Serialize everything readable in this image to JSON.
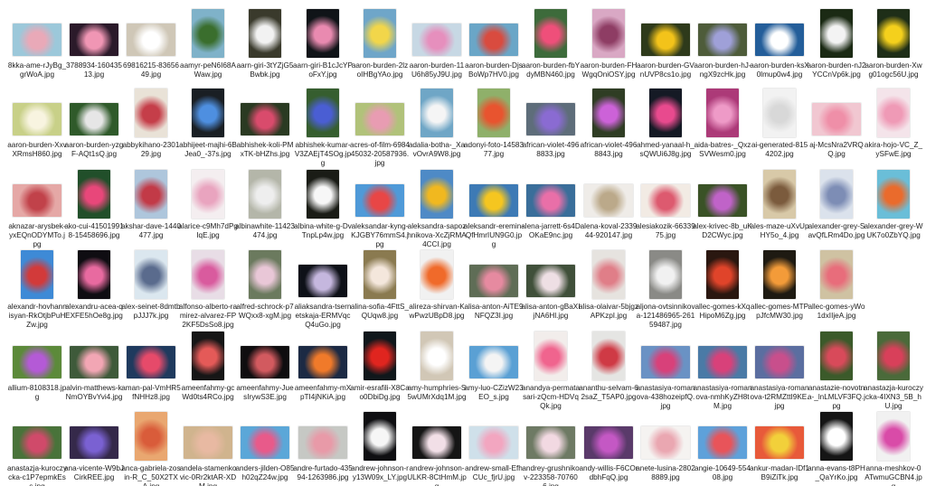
{
  "rows": [
    [
      {
        "label": "8kka-ame-rJyBg_grWoA.jpg",
        "orient": "l",
        "c1": "#9cc8da",
        "c2": "#e9a9b8"
      },
      {
        "label": "3788934-16043513.jpg",
        "orient": "l",
        "c1": "#2b1a2a",
        "c2": "#f096b4"
      },
      {
        "label": "69816215-8365649.jpg",
        "orient": "l",
        "c1": "#cfc7b7",
        "c2": "#ffffff"
      },
      {
        "label": "aamyr-peN6I68AWaw.jpg",
        "orient": "p",
        "c1": "#7fb2c9",
        "c2": "#3a6e2d"
      },
      {
        "label": "aarn-giri-3tYZjG5Bwbk.jpg",
        "orient": "p",
        "c1": "#3a3a2c",
        "c2": "#f2f2f2"
      },
      {
        "label": "aarn-giri-B1cJcYPoFxY.jpg",
        "orient": "p",
        "c1": "#101418",
        "c2": "#e98ab0"
      },
      {
        "label": "aaron-burden-2lzoIHBgYAo.jpg",
        "orient": "p",
        "c1": "#6fa6c9",
        "c2": "#f2d64a"
      },
      {
        "label": "aaron-burden-11U6h85yJ9U.jpg",
        "orient": "l",
        "c1": "#c7d8e4",
        "c2": "#e68fbd"
      },
      {
        "label": "aaron-burden-DjsBoWp7HV0.jpg",
        "orient": "l",
        "c1": "#6aa6c7",
        "c2": "#d94b3f"
      },
      {
        "label": "aaron-burden-fbYdyMBN460.jpg",
        "orient": "p",
        "c1": "#3d6b3b",
        "c2": "#ef4f7a"
      },
      {
        "label": "aaron-burden-FHWgqOniOSY.jpg",
        "orient": "p",
        "c1": "#d9a8c4",
        "c2": "#8e3d64"
      },
      {
        "label": "aaron-burden-GVnUVP8cs1o.jpg",
        "orient": "l",
        "c1": "#2e3a1b",
        "c2": "#f3c31a"
      },
      {
        "label": "aaron-burden-hJ-ngX9zcHk.jpg",
        "orient": "l",
        "c1": "#4e5c3a",
        "c2": "#9fa0d8"
      },
      {
        "label": "aaron-burden-ksX0lmup0w4.jpg",
        "orient": "l",
        "c1": "#245e9a",
        "c2": "#ffffff"
      },
      {
        "label": "aaron-burden-nJ2YCCnVp6k.jpg",
        "orient": "p",
        "c1": "#1b2a14",
        "c2": "#f3f3f3"
      },
      {
        "label": "aaron-burden-Xwg01ogc56U.jpg",
        "orient": "p",
        "c1": "#1e2e18",
        "c2": "#f4d01c"
      }
    ],
    [
      {
        "label": "aaron-burden-XxvXRmsH860.jpg",
        "orient": "l",
        "c1": "#c8d088",
        "c2": "#f8f4e0"
      },
      {
        "label": "aaron-burden-yzgF-AQt1sQ.jpg",
        "orient": "l",
        "c1": "#2f5a2a",
        "c2": "#e6e6e6"
      },
      {
        "label": "abbykihano-230129.jpg",
        "orient": "p",
        "c1": "#e9e2d7",
        "c2": "#c53e49"
      },
      {
        "label": "abhijeet-majhi-6BJea0_-37s.jpg",
        "orient": "p",
        "c1": "#1a1f24",
        "c2": "#4e8fe0"
      },
      {
        "label": "abhishek-koli-PMxTK-bHZhs.jpg",
        "orient": "l",
        "c1": "#2a3a22",
        "c2": "#d94b6c"
      },
      {
        "label": "abhishek-kumar-V3ZAEjT4SOg.jpg",
        "orient": "p",
        "c1": "#365e2f",
        "c2": "#4a5ed3"
      },
      {
        "label": "acres-of-film-698445032-20587936.jpg",
        "orient": "l",
        "c1": "#b1c27a",
        "c2": "#e89cb2"
      },
      {
        "label": "adalia-botha-_XavOvrA9W8.jpg",
        "orient": "p",
        "c1": "#6fa6c6",
        "c2": "#f5f5f5"
      },
      {
        "label": "adonyi-foto-1458377.jpg",
        "orient": "p",
        "c1": "#8fb06a",
        "c2": "#e8542f"
      },
      {
        "label": "african-violet-4968833.jpg",
        "orient": "l",
        "c1": "#5e6d7a",
        "c2": "#8a6bd2"
      },
      {
        "label": "african-violet-4968843.jpg",
        "orient": "p",
        "c1": "#2f3d24",
        "c2": "#cc62d8"
      },
      {
        "label": "ahmed-yanaal-h_sQWUi6J8g.jpg",
        "orient": "p",
        "c1": "#151a25",
        "c2": "#e84a8e"
      },
      {
        "label": "aida-batres-_QxzSVWesm0.jpg",
        "orient": "p",
        "c1": "#ac3a78",
        "c2": "#ee9ac7"
      },
      {
        "label": "ai-generated-8154202.jpg",
        "orient": "p",
        "c1": "#f2f2f2",
        "c2": "#d8d8d8"
      },
      {
        "label": "aj-McsNra2VRQQ.jpg",
        "orient": "l",
        "c1": "#f1c7d1",
        "c2": "#ef8fa8"
      },
      {
        "label": "akira-hojo-VC_Z_ySFwE.jpg",
        "orient": "p",
        "c1": "#f4e4ea",
        "c2": "#ef9ab6"
      }
    ],
    [
      {
        "label": "aknazar-arysbek-yxEQnODYMTo.jpg",
        "orient": "l",
        "c1": "#e5a8a6",
        "c2": "#c1424a"
      },
      {
        "label": "ako-cui-415019918-15458696.jpg",
        "orient": "p",
        "c1": "#214f2a",
        "c2": "#e8477a"
      },
      {
        "label": "akshar-dave-1440477.jpg",
        "orient": "p",
        "c1": "#aec6dc",
        "c2": "#c23a47"
      },
      {
        "label": "alarice-c9Mh7dPgIqE.jpg",
        "orient": "p",
        "c1": "#f4eef0",
        "c2": "#e9a4bf"
      },
      {
        "label": "albinawhite-11423474.jpg",
        "orient": "p",
        "c1": "#b4b6a9",
        "c2": "#eeeeee"
      },
      {
        "label": "albina-white-g-DvTnpLp4w.jpg",
        "orient": "p",
        "c1": "#1a1c16",
        "c2": "#f7f7f7"
      },
      {
        "label": "aleksandar-kyng-KJGBY76mmS4.jpg",
        "orient": "l",
        "c1": "#4f9ad8",
        "c2": "#e84646"
      },
      {
        "label": "aleksandra-sapozhnikova-XcZjRMA4CCI.jpg",
        "orient": "p",
        "c1": "#4e8ac6",
        "c2": "#f1b81f"
      },
      {
        "label": "aleksandr-eremin-QfHmrIUN9G0.jpg",
        "orient": "l",
        "c1": "#3d7ab5",
        "c2": "#f5c620"
      },
      {
        "label": "alena-jarrett-6s4DOKaE9nc.jpg",
        "orient": "l",
        "c1": "#3a6e9a",
        "c2": "#e96fa8"
      },
      {
        "label": "alena-koval-233944-920147.jpg",
        "orient": "l",
        "c1": "#efece8",
        "c2": "#bba98a"
      },
      {
        "label": "alesiakozik-6633975.jpg",
        "orient": "l",
        "c1": "#f2ebe4",
        "c2": "#dd5a6f"
      },
      {
        "label": "alex-krivec-8b_uKD2CWyc.jpg",
        "orient": "l",
        "c1": "#3a5226",
        "c2": "#c063c8"
      },
      {
        "label": "ales-maze-uXvUpHY5o_4.jpg",
        "orient": "p",
        "c1": "#d8c9a8",
        "c2": "#7b5b3d"
      },
      {
        "label": "alexander-grey-SavQfLRm4Do.jpg",
        "orient": "p",
        "c1": "#dbe2ec",
        "c2": "#7d8db5"
      },
      {
        "label": "alexander-grey-WUK7o0ZbYQ.jpg",
        "orient": "p",
        "c1": "#6abed8",
        "c2": "#ea6b2c"
      }
    ],
    [
      {
        "label": "alexandr-hovhannisyan-RkOtjbPuHZw.jpg",
        "orient": "p",
        "c1": "#3e8ad6",
        "c2": "#d23a3a"
      },
      {
        "label": "alexandru-acea-qEXFE5hOe8g.jpg",
        "orient": "p",
        "c1": "#0f0d12",
        "c2": "#e86aa0"
      },
      {
        "label": "alex-seinet-8dmtbpJJJ7k.jpg",
        "orient": "p",
        "c1": "#dbe7ef",
        "c2": "#5a6b8d"
      },
      {
        "label": "alfonso-alberto-ramirez-alvarez-FP2KF5DsSo8.jpg",
        "orient": "p",
        "c1": "#e8dde6",
        "c2": "#d95b9e"
      },
      {
        "label": "alfred-schrock-p7WQxx8-xgM.jpg",
        "orient": "p",
        "c1": "#6b7a5e",
        "c2": "#e9c7d7"
      },
      {
        "label": "aliaksandra-tsernetskaja-ERMVqcQ4uGo.jpg",
        "orient": "l",
        "c1": "#0e1118",
        "c2": "#c5b7de"
      },
      {
        "label": "alina-sofia-4FttS_QUqw8.jpg",
        "orient": "p",
        "c1": "#8a7a50",
        "c2": "#f4e7dc"
      },
      {
        "label": "alireza-shirvan-KwPwzUBpD8.jpg",
        "orient": "p",
        "c1": "#f1f1f1",
        "c2": "#f06a2a"
      },
      {
        "label": "alisa-anton-AiTE9NFQZ3I.jpg",
        "orient": "l",
        "c1": "#5f6d56",
        "c2": "#e68aa0"
      },
      {
        "label": "alisa-anton-gBaXIjNA6Hl.jpg",
        "orient": "l",
        "c1": "#40503a",
        "c2": "#eedfe4"
      },
      {
        "label": "alisa-olaivar-5bjgzAPKzpI.jpg",
        "orient": "p",
        "c1": "#e6e3df",
        "c2": "#e07e88"
      },
      {
        "label": "aljona-ovtsinnikova-121486965-26159487.jpg",
        "orient": "p",
        "c1": "#8a8a86",
        "c2": "#f1f1f1"
      },
      {
        "label": "allec-gomes-kXqHipoM6Zg.jpg",
        "orient": "p",
        "c1": "#2a1710",
        "c2": "#e0442a"
      },
      {
        "label": "allec-gomes-MTPpJfcMW30.jpg",
        "orient": "p",
        "c1": "#1e1a12",
        "c2": "#f39b39"
      },
      {
        "label": "allec-gomes-yWo1dxIIjeA.jpg",
        "orient": "p",
        "c1": "#cfc2a2",
        "c2": "#e86d7b"
      }
    ],
    [
      {
        "label": "allium-8108318.jpg",
        "orient": "l",
        "c1": "#5c8a3a",
        "c2": "#b45ad6"
      },
      {
        "label": "alvin-matthews-kNmOYBvYvi4.jpg",
        "orient": "l",
        "c1": "#3e5a3a",
        "c2": "#f2a6b4"
      },
      {
        "label": "aman-pal-VmHR5fNHHz8.jpg",
        "orient": "l",
        "c1": "#1f3a5e",
        "c2": "#e64a6a"
      },
      {
        "label": "ameenfahmy-gcWd0ts4RCo.jpg",
        "orient": "p",
        "c1": "#161616",
        "c2": "#e45a58"
      },
      {
        "label": "ameenfahmy-JuesIrywS3E.jpg",
        "orient": "l",
        "c1": "#0f0d0f",
        "c2": "#d25a5f"
      },
      {
        "label": "ameenfahmy-mXpTI4jNKiA.jpg",
        "orient": "l",
        "c1": "#1c2a44",
        "c2": "#f07a2a"
      },
      {
        "label": "amir-esrafili-X8Cao0DbiDg.jpg",
        "orient": "p",
        "c1": "#10171b",
        "c2": "#e0251f"
      },
      {
        "label": "amy-humphries-S5wUMrXdq1M.jpg",
        "orient": "p",
        "c1": "#d1c7b6",
        "c2": "#ffffff"
      },
      {
        "label": "amy-luo-CZizW23EO_s.jpg",
        "orient": "l",
        "c1": "#5aa0d4",
        "c2": "#f4f4f4"
      },
      {
        "label": "anandya-permatasari-zQcm-HDVqQk.jpg",
        "orient": "p",
        "c1": "#f2edeb",
        "c2": "#f0648e"
      },
      {
        "label": "ananthu-selvam-62saZ_T5AP0.jpg",
        "orient": "p",
        "c1": "#e5e5e3",
        "c2": "#cf3a45"
      },
      {
        "label": "anastasiya-romanova-438hozeipfQ.jpg",
        "orient": "l",
        "c1": "#6a92c4",
        "c2": "#d8417a"
      },
      {
        "label": "anastasiya-romanova-nmhKyZH8tM.jpg",
        "orient": "l",
        "c1": "#4a7aa6",
        "c2": "#d8417a"
      },
      {
        "label": "anastasiya-romanova-t2RMZttI9KE.jpg",
        "orient": "l",
        "c1": "#5b6ea0",
        "c2": "#c84f8c"
      },
      {
        "label": "anastazie-novotna-_lnLMLVF3FQ.jpg",
        "orient": "p",
        "c1": "#3b5a2a",
        "c2": "#d84a5a"
      },
      {
        "label": "anastazja-kuroczycka-4IXN3_5B_hU.jpg",
        "orient": "p",
        "c1": "#4a6a3a",
        "c2": "#d8405a"
      }
    ],
    [
      {
        "label": "anastazja-kuroczycka-c1P7epmkEss.jpg",
        "orient": "l",
        "c1": "#49733a",
        "c2": "#d04a6a"
      },
      {
        "label": "ana-vicente-W9bJCirkREE.jpg",
        "orient": "l",
        "c1": "#35294a",
        "c2": "#7a61d2"
      },
      {
        "label": "anca-gabriela-zosin-R_C_50X2TXA.jpg",
        "orient": "p",
        "c1": "#e9a770",
        "c2": "#d95c3a"
      },
      {
        "label": "andela-stamenkovic-0Rr2ktAR-XDM.jpg",
        "orient": "l",
        "c1": "#d0b48e",
        "c2": "#e8b9a2"
      },
      {
        "label": "anders-jilden-O85h02qZ24w.jpg",
        "orient": "l",
        "c1": "#5ba7d8",
        "c2": "#e85a8a"
      },
      {
        "label": "andre-furtado-43594-1263986.jpg",
        "orient": "l",
        "c1": "#c6c8c4",
        "c2": "#e89aa8"
      },
      {
        "label": "andrew-johnson-ry13W09x_LY.jpg",
        "orient": "p",
        "c1": "#0f0f12",
        "c2": "#f6f6f6"
      },
      {
        "label": "andrew-johnson-ULKR-8CtHmM.jpg",
        "orient": "l",
        "c1": "#151515",
        "c2": "#f2dfe7"
      },
      {
        "label": "andrew-small-EfhCUc_fjrU.jpg",
        "orient": "l",
        "c1": "#cfe0ea",
        "c2": "#f2a6c0"
      },
      {
        "label": "andrey-grushnikov-223358-707606.jpg",
        "orient": "l",
        "c1": "#6e7a64",
        "c2": "#f2d9e2"
      },
      {
        "label": "andy-willis-F6COrdbhFqQ.jpg",
        "orient": "l",
        "c1": "#5a3a6a",
        "c2": "#c458c4"
      },
      {
        "label": "anete-lusina-28028889.jpg",
        "orient": "l",
        "c1": "#f5f3f1",
        "c2": "#eaa7b1"
      },
      {
        "label": "angie-10649-55408.jpg",
        "orient": "l",
        "c1": "#5ea1da",
        "c2": "#e8545a"
      },
      {
        "label": "ankur-madan-IDf1B9iZiTk.jpg",
        "orient": "l",
        "c1": "#e85a3a",
        "c2": "#f2d03a"
      },
      {
        "label": "anna-evans-t8PH_QaYrKo.jpg",
        "orient": "p",
        "c1": "#151515",
        "c2": "#ffffff"
      },
      {
        "label": "anna-meshkov-0ATwmuGCBN4.jpg",
        "orient": "p",
        "c1": "#f1f1f1",
        "c2": "#d94ba8"
      }
    ]
  ]
}
